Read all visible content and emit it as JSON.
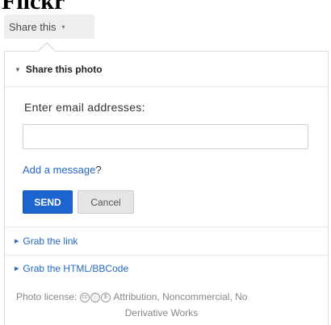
{
  "page": {
    "title": "Flickr"
  },
  "share_button": {
    "label": "Share this",
    "caret": "▾"
  },
  "share_photo": {
    "heading": "Share this photo",
    "email_label": "Enter email addresses:",
    "email_value": "",
    "email_placeholder": "",
    "add_message_link": "Add a message",
    "add_message_suffix": "?",
    "send_label": "SEND",
    "cancel_label": "Cancel"
  },
  "grab_link": {
    "label": "Grab the link"
  },
  "grab_html": {
    "label": "Grab the HTML/BBCode"
  },
  "license": {
    "prefix": "Photo license:",
    "icons": [
      "cc-icon",
      "by-icon",
      "nc-icon"
    ],
    "line1": "Attribution, Noncommercial, No",
    "line2": "Derivative Works"
  },
  "colors": {
    "link": "#2468c5",
    "send_bg": "#1c64d0",
    "cancel_bg": "#e6e6e6",
    "share_btn_bg": "#eeeeee"
  }
}
